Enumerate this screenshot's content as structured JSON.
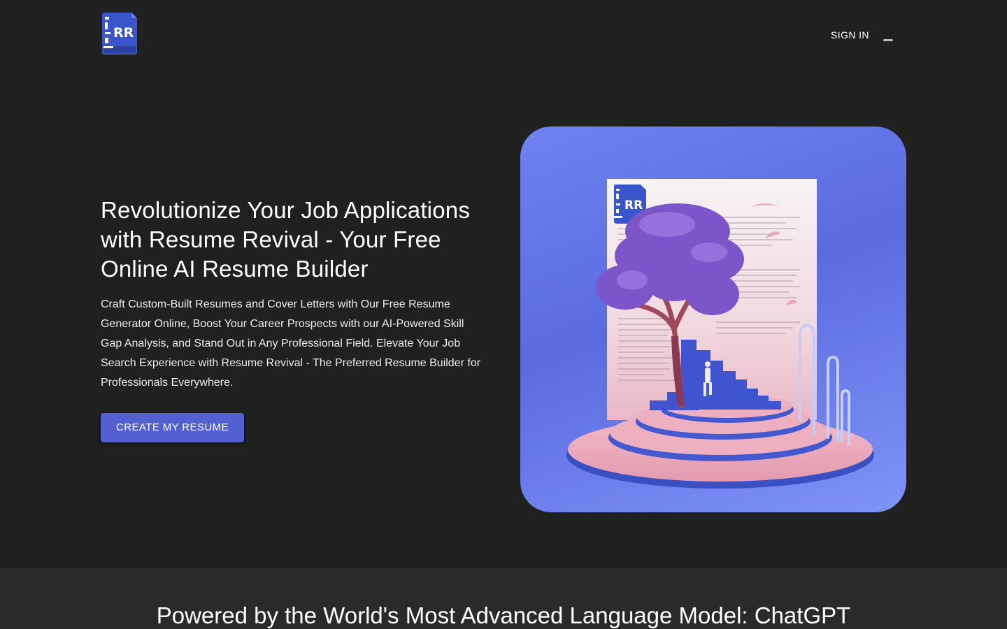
{
  "header": {
    "logo_text": "RR",
    "signin_label": "SIGN IN",
    "theme_icon": "moon-icon"
  },
  "hero": {
    "title": "Revolutionize Your Job Applications with Resume Revival - Your Free Online AI Resume Builder",
    "description": "Craft Custom-Built Resumes and Cover Letters with Our Free Resume Generator Online, Boost Your Career Prospects with our AI-Powered Skill Gap Analysis, and Stand Out in Any Professional Field. Elevate Your Job Search Experience with Resume Revival - The Preferred Resume Builder for Professionals Everywhere.",
    "cta_label": "CREATE MY RESUME",
    "image_logo_text": "RR"
  },
  "section2": {
    "title": "Powered by the World's Most Advanced Language Model: ChatGPT"
  },
  "colors": {
    "background": "#202021",
    "accent": "#5360d0",
    "section_bg": "#2a2a2b",
    "logo_blue": "#3a55c9"
  }
}
